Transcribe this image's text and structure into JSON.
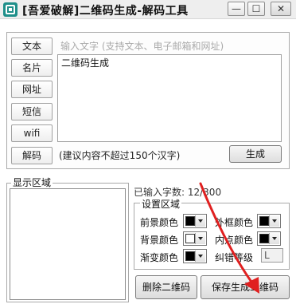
{
  "window": {
    "title": "[吾爱破解]二维码生成-解码工具",
    "minimize_glyph": "—",
    "maximize_glyph": "☐",
    "close_glyph": "✕"
  },
  "sidebar": {
    "items": [
      {
        "label": "文本"
      },
      {
        "label": "名片"
      },
      {
        "label": "网址"
      },
      {
        "label": "短信"
      },
      {
        "label": "wifi"
      },
      {
        "label": "解码"
      }
    ]
  },
  "input": {
    "placeholder": "输入文字 (支持文本、电子邮箱和网址)",
    "content": "二维码生成",
    "hint": "(建议内容不超过150个汉字)"
  },
  "buttons": {
    "generate": "生成",
    "delete": "删除二维码",
    "save": "保存生成二维码"
  },
  "display": {
    "legend": "显示区域",
    "char_count": "已输入字数: 12/300"
  },
  "settings": {
    "legend": "设置区域",
    "foreground_color_label": "前景颜色",
    "foreground_color": "#000000",
    "outer_frame_color_label": "外框颜色",
    "outer_frame_color": "#000000",
    "background_color_label": "背景颜色",
    "background_color": "#ffffff",
    "inner_point_color_label": "内点颜色",
    "inner_point_color": "#000000",
    "gradient_color_label": "渐变颜色",
    "gradient_color": "#000000",
    "error_level_label": "纠错等级",
    "error_level": "L"
  },
  "colors": {
    "accent_arrow": "#e02020",
    "app_icon": "#1f8f8a"
  }
}
